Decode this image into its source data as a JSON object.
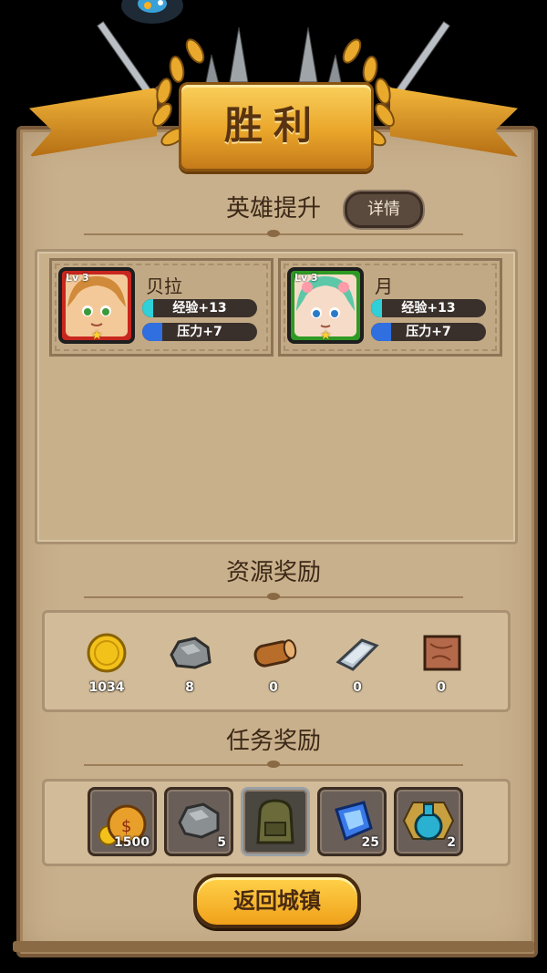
{
  "banner": {
    "title": "胜利"
  },
  "hero_section": {
    "title": "英雄提升",
    "detail_label": "详情",
    "heroes": [
      {
        "level": "Lv 3",
        "name": "贝拉",
        "exp": "经验+13",
        "stress": "压力+7",
        "frame_color": "#c8261e"
      },
      {
        "level": "Lv 3",
        "name": "月",
        "exp": "经验+13",
        "stress": "压力+7",
        "frame_color": "#2e9a24"
      }
    ]
  },
  "resource_section": {
    "title": "资源奖励",
    "items": [
      {
        "icon": "gold-coin-icon",
        "value": "1034"
      },
      {
        "icon": "stone-icon",
        "value": "8"
      },
      {
        "icon": "wood-log-icon",
        "value": "0"
      },
      {
        "icon": "iron-ingot-icon",
        "value": "0"
      },
      {
        "icon": "leather-icon",
        "value": "0"
      }
    ]
  },
  "mission_section": {
    "title": "任务奖励",
    "items": [
      {
        "icon": "gold-sack-icon",
        "qty": "1500"
      },
      {
        "icon": "stone-icon",
        "qty": "5"
      },
      {
        "icon": "backpack-icon",
        "qty": ""
      },
      {
        "icon": "blue-crystal-icon",
        "qty": "25"
      },
      {
        "icon": "potion-icon",
        "qty": "2"
      }
    ]
  },
  "return_button": {
    "label": "返回城镇"
  },
  "colors": {
    "exp_bar": "#2fd0d8",
    "stress_bar": "#2f6fe0",
    "accent_gold": "#f0a11a"
  }
}
